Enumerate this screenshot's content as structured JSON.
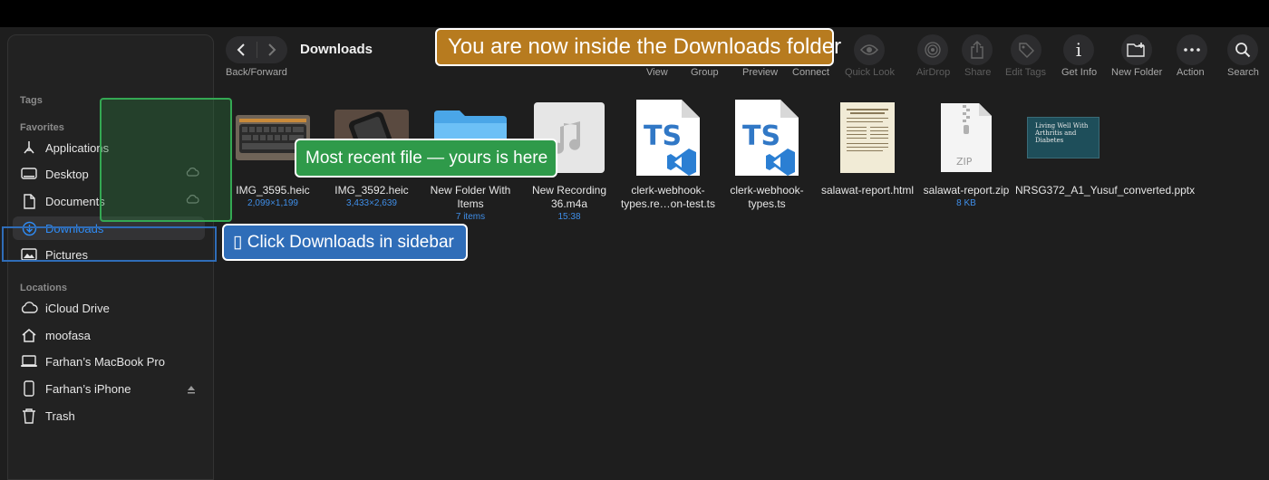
{
  "toolbar": {
    "back_forward_label": "Back/Forward",
    "folder_title": "Downloads",
    "buttons": [
      {
        "label": "View",
        "icon": "view-icon",
        "dim": false
      },
      {
        "label": "Group",
        "icon": "group-icon",
        "dim": false
      },
      {
        "label": "Preview",
        "icon": "preview-icon",
        "dim": false
      },
      {
        "label": "Connect",
        "icon": "connect-icon",
        "dim": false
      },
      {
        "label": "Quick Look",
        "icon": "eye-icon",
        "dim": true
      },
      {
        "label": "AirDrop",
        "icon": "airdrop-icon",
        "dim": true
      },
      {
        "label": "Share",
        "icon": "share-icon",
        "dim": true
      },
      {
        "label": "Edit Tags",
        "icon": "tag-icon",
        "dim": true
      },
      {
        "label": "Get Info",
        "icon": "info-icon",
        "dim": false
      },
      {
        "label": "New Folder",
        "icon": "new-folder-icon",
        "dim": false
      },
      {
        "label": "Action",
        "icon": "ellipsis-icon",
        "dim": false
      },
      {
        "label": "Search",
        "icon": "search-icon",
        "dim": false
      }
    ]
  },
  "sidebar": {
    "tags_header": "Tags",
    "favorites_header": "Favorites",
    "favorites": [
      {
        "label": "Applications",
        "icon": "applications-icon"
      },
      {
        "label": "Desktop",
        "icon": "desktop-icon"
      },
      {
        "label": "Documents",
        "icon": "document-icon"
      },
      {
        "label": "Downloads",
        "icon": "downloads-icon",
        "selected": true
      },
      {
        "label": "Pictures",
        "icon": "pictures-icon"
      }
    ],
    "locations_header": "Locations",
    "locations": [
      {
        "label": "iCloud Drive",
        "icon": "cloud-icon"
      },
      {
        "label": "moofasa",
        "icon": "home-icon"
      },
      {
        "label": "Farhan’s MacBook Pro",
        "icon": "laptop-icon"
      },
      {
        "label": "Farhan’s iPhone",
        "icon": "iphone-icon"
      },
      {
        "label": "Trash",
        "icon": "trash-icon"
      }
    ]
  },
  "files": [
    {
      "name": "IMG_3595.heic",
      "meta": "2,099×1,199",
      "icon": "image-thumbnail-keyboard"
    },
    {
      "name": "IMG_3592.heic",
      "meta": "3,433×2,639",
      "icon": "image-thumbnail-phone"
    },
    {
      "name": "New Folder With Items",
      "meta": "7 items",
      "icon": "folder-icon"
    },
    {
      "name": "New Recording 36.m4a",
      "meta": "15:38",
      "icon": "audio-file-icon"
    },
    {
      "name": "clerk-webhook-types.re…on-test.ts",
      "meta": "",
      "icon": "typescript-file-icon"
    },
    {
      "name": "clerk-webhook-types.ts",
      "meta": "",
      "icon": "typescript-file-icon"
    },
    {
      "name": "salawat-report.html",
      "meta": "",
      "icon": "html-document-thumbnail"
    },
    {
      "name": "salawat-report.zip",
      "meta": "8 KB",
      "icon": "zip-file-icon"
    },
    {
      "name": "NRSG372_A1_Yusuf_converted.pptx",
      "meta": "",
      "icon": "pptx-thumbnail"
    }
  ],
  "pptx_thumb_text": "Living Well With Arthritis and Diabetes",
  "zip_badge": "ZIP",
  "ts_badge": "TS",
  "overlays": {
    "orange": "You are now inside the Downloads folder",
    "green": "Most recent file — yours is here",
    "blue": "▯ Click Downloads in sidebar"
  },
  "colors": {
    "accent": "#2f8cf6",
    "orange": "#b77b1f",
    "green": "#2f9a4a",
    "blue": "#2f6db8"
  }
}
